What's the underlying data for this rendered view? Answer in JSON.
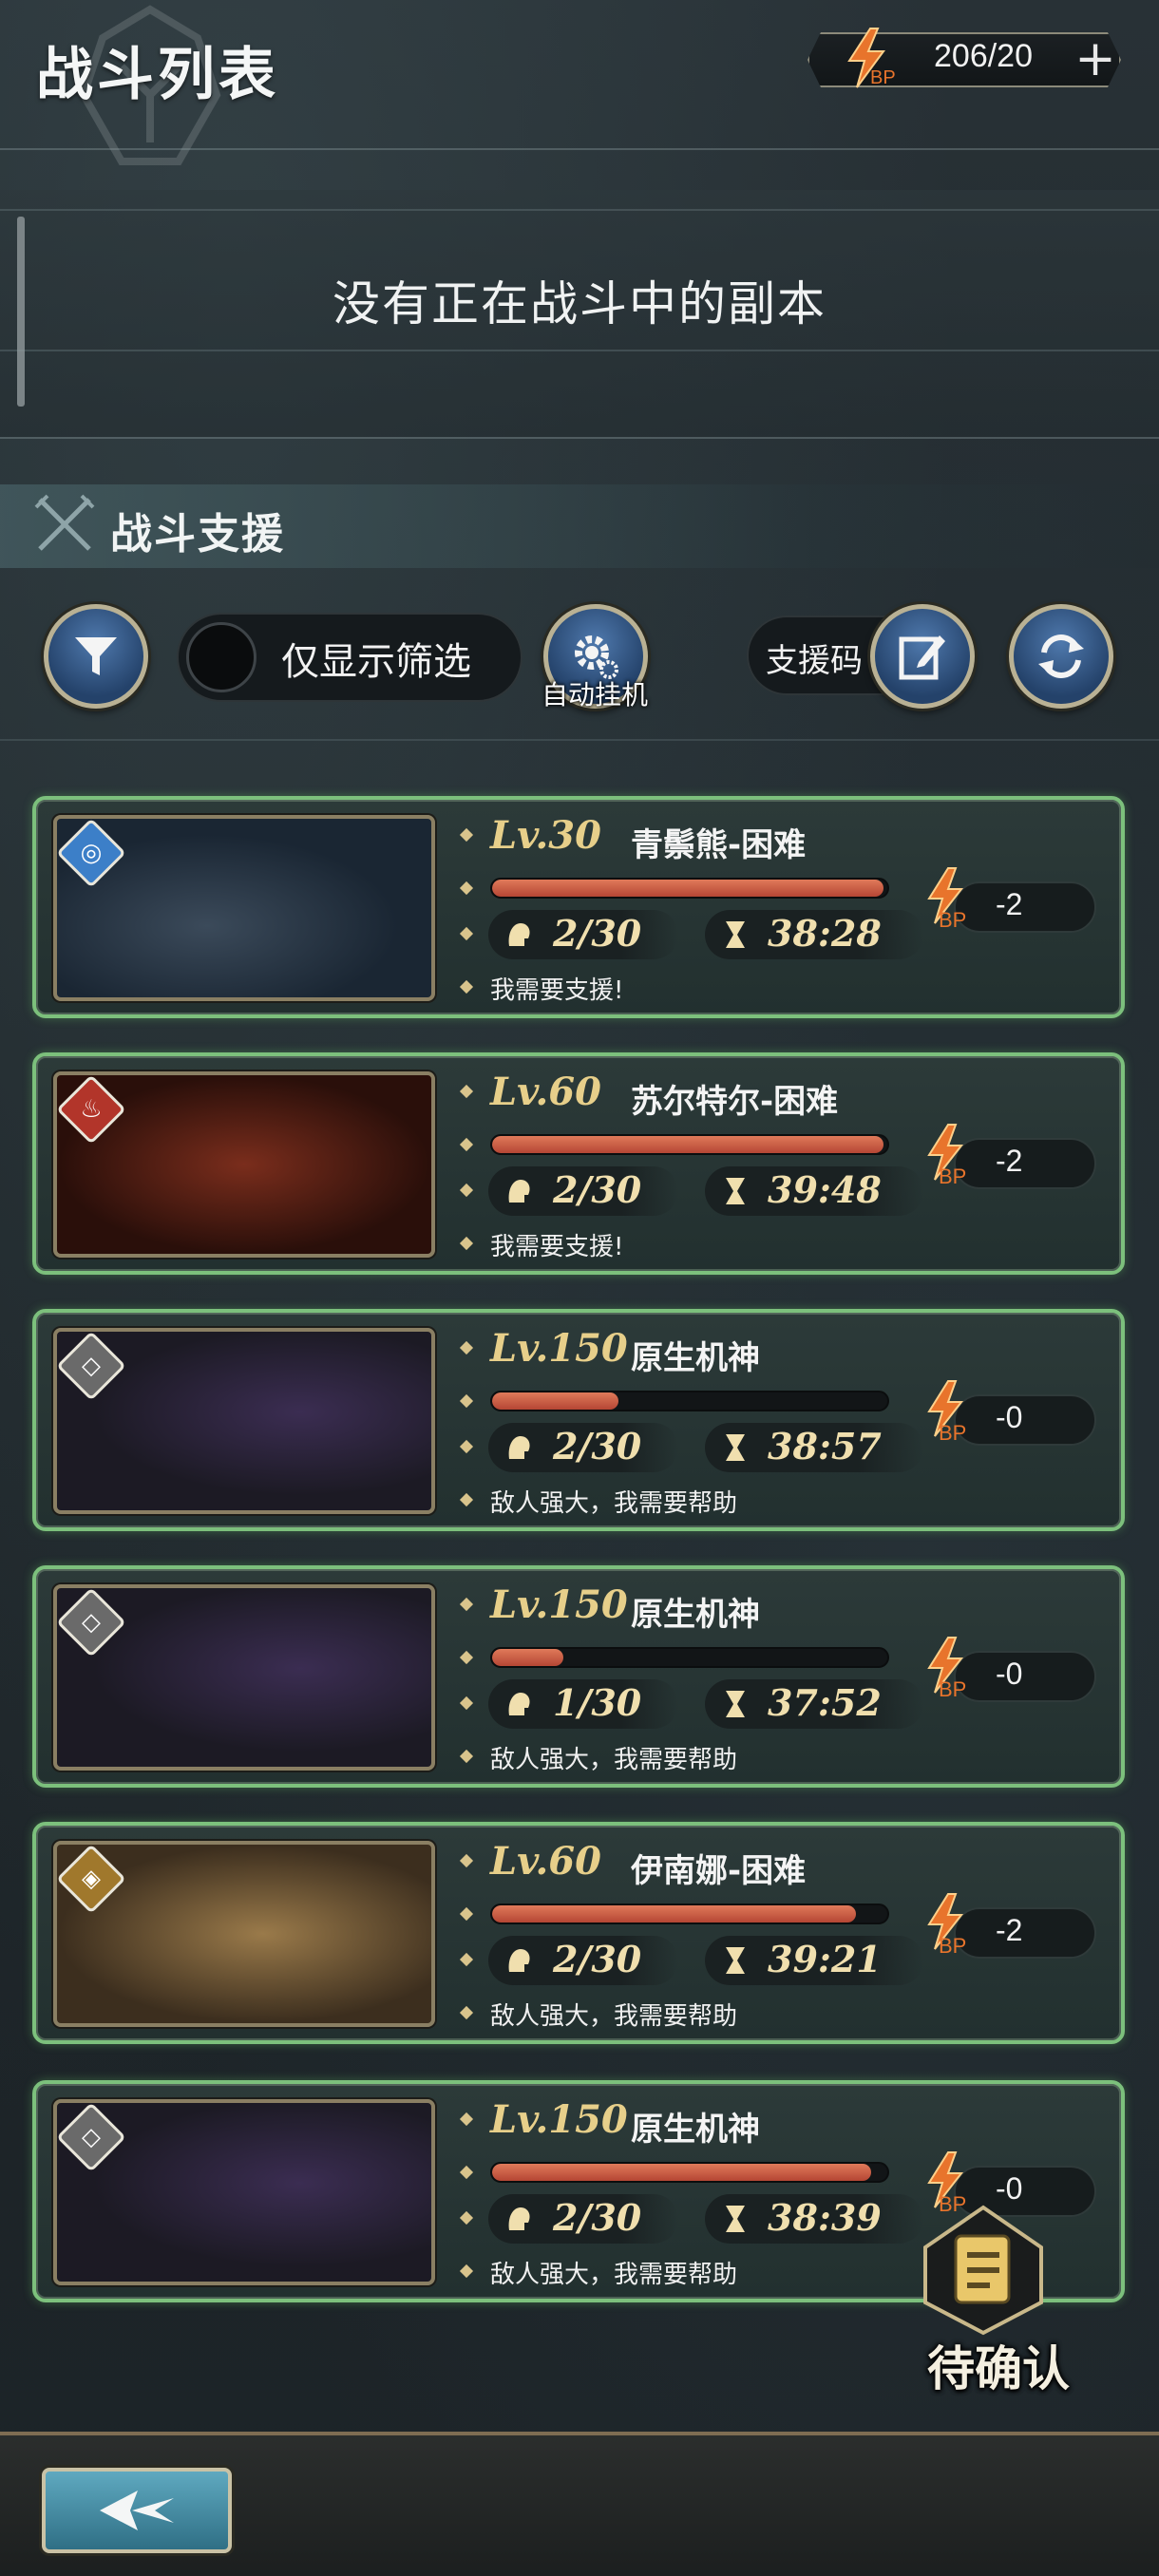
{
  "header": {
    "title": "战斗列表",
    "bp_value": "206/20",
    "bp_label": "BP",
    "plus": "+"
  },
  "active": {
    "empty_text": "没有正在战斗中的副本"
  },
  "support_section": {
    "title": "战斗支援"
  },
  "toolbar": {
    "toggle_label": "仅显示筛选",
    "auto_label": "自动挂机",
    "support_code_label": "支援码"
  },
  "colors": {
    "card_border": "#7cc07c",
    "hp_fill": "#c9553e",
    "level_text": "#e7cf8a"
  },
  "cards": [
    {
      "level": "Lv.30",
      "name": "青鬃熊-困难",
      "hp_fraction": 0.99,
      "players": "2/30",
      "time": "38:28",
      "bp_cost": "-2",
      "message": "我需要支援!",
      "element": "water"
    },
    {
      "level": "Lv.60",
      "name": "苏尔特尔-困难",
      "hp_fraction": 0.99,
      "players": "2/30",
      "time": "39:48",
      "bp_cost": "-2",
      "message": "我需要支援!",
      "element": "fire"
    },
    {
      "level": "Lv.150",
      "name": "原生机神",
      "hp_fraction": 0.32,
      "players": "2/30",
      "time": "38:57",
      "bp_cost": "-0",
      "message": "敌人强大，我需要帮助",
      "element": "none"
    },
    {
      "level": "Lv.150",
      "name": "原生机神",
      "hp_fraction": 0.18,
      "players": "1/30",
      "time": "37:52",
      "bp_cost": "-0",
      "message": "敌人强大，我需要帮助",
      "element": "none"
    },
    {
      "level": "Lv.60",
      "name": "伊南娜-困难",
      "hp_fraction": 0.92,
      "players": "2/30",
      "time": "39:21",
      "bp_cost": "-2",
      "message": "敌人强大，我需要帮助",
      "element": "earth"
    },
    {
      "level": "Lv.150",
      "name": "原生机神",
      "hp_fraction": 0.96,
      "players": "2/30",
      "time": "38:39",
      "bp_cost": "-0",
      "message": "敌人强大，我需要帮助",
      "element": "none"
    }
  ],
  "pending": {
    "label": "待确认"
  }
}
